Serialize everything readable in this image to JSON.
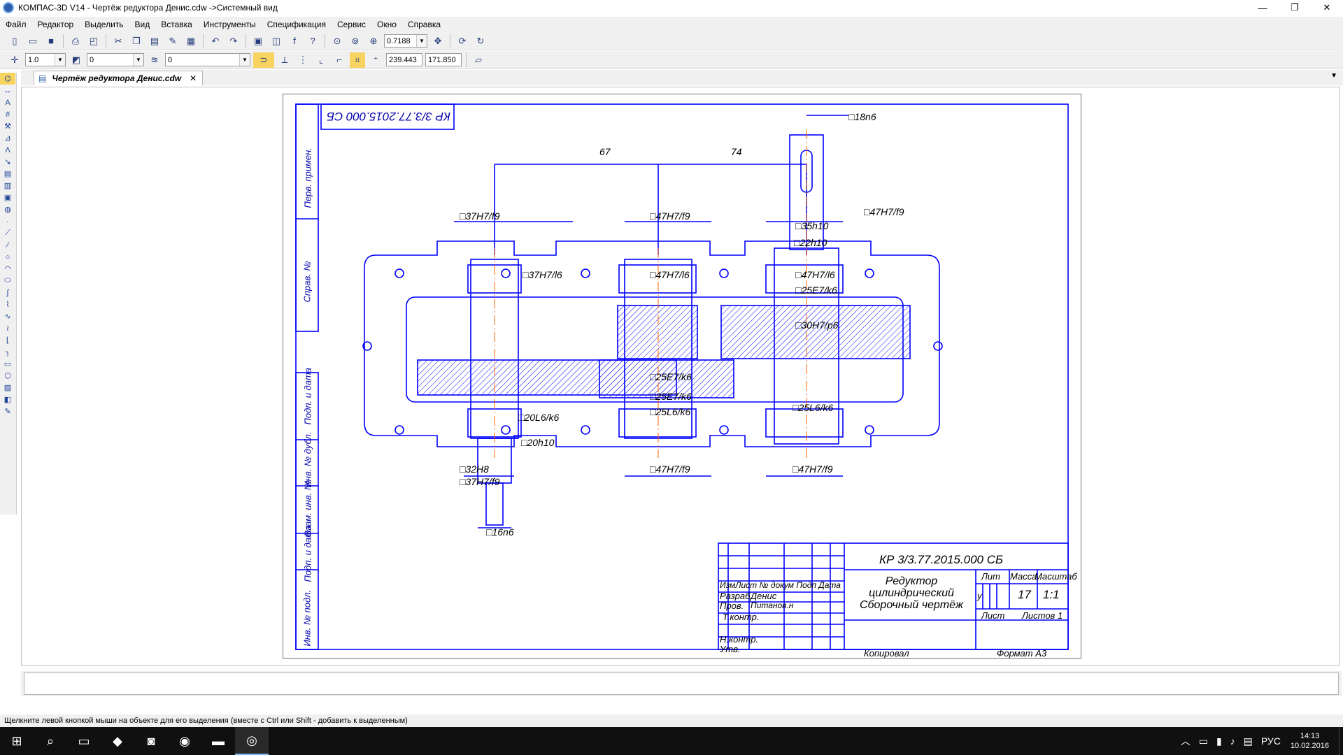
{
  "window": {
    "title": "КОМПАС-3D V14 - Чертёж  редуктора Денис.cdw ->Системный вид",
    "controls": [
      "—",
      "❐",
      "✕"
    ]
  },
  "menu": [
    "Файл",
    "Редактор",
    "Выделить",
    "Вид",
    "Вставка",
    "Инструменты",
    "Спецификация",
    "Сервис",
    "Окно",
    "Справка"
  ],
  "toolbar1": {
    "zoom": "0.7188"
  },
  "toolbar2": {
    "step": "1.0",
    "angle": "0",
    "layer": "0",
    "coord_x": "239.443",
    "coord_y": "171.850"
  },
  "tab": {
    "label": "Чертёж  редуктора Денис.cdw",
    "close": "✕"
  },
  "drawing": {
    "stamp_top": "КР 3/3.77.2015.000 СБ",
    "side_labels": [
      "Перв. примен.",
      "Справ. №",
      "Подп. и дата",
      "Инв. № дубл.",
      "Взам. инв. №",
      "Подп. и дата",
      "Инв. № подл."
    ],
    "dims": [
      "67",
      "74",
      "□18n6",
      "□37H7/f9",
      "□47H7/f9",
      "□47H7/f9",
      "□35h10",
      "□22h10",
      "□37H7/l6",
      "□47H7/l6",
      "□47H7/l6",
      "□25E7/k6",
      "□30H7/p6",
      "□25E7/k6",
      "□25E7/k6",
      "□25L6/k6",
      "□25L6/k6",
      "□20L6/k6",
      "□20h10",
      "□32H8",
      "□37H7/f9",
      "□47H7/f9",
      "□47H7/f9",
      "□16n6"
    ],
    "title_block": {
      "designation": "КР 3/3.77.2015.000 СБ",
      "name_line1": "Редуктор",
      "name_line2": "цилиндрический",
      "name_line3": "Сборочный чертёж",
      "col_lit": "Лит",
      "col_mass": "Масса",
      "col_scale": "Масштаб",
      "lit_value": "у",
      "mass_value": "17",
      "scale_value": "1:1",
      "sheet_label": "Лист",
      "sheets_label": "Листов 1",
      "header_row": "ИзмЛист № докум Подп Дата",
      "role1": "Разраб",
      "person1": "Денис",
      "role2": "Пров.",
      "person2": "Питанов.н",
      "role3": "Т.контр.",
      "role4": "Н.контр.",
      "role5": "Утв.",
      "copied": "Копировал",
      "format": "Формат А3"
    }
  },
  "status": "Щелкните левой кнопкой мыши на объекте для его выделения (вместе с Ctrl или Shift - добавить к выделенным)",
  "taskbar": {
    "lang": "РУС",
    "time": "14:13",
    "date": "10.02.2016"
  },
  "colors": {
    "line": "#0000ff",
    "axis": "#ff6600",
    "accent": "#2f5faa"
  }
}
